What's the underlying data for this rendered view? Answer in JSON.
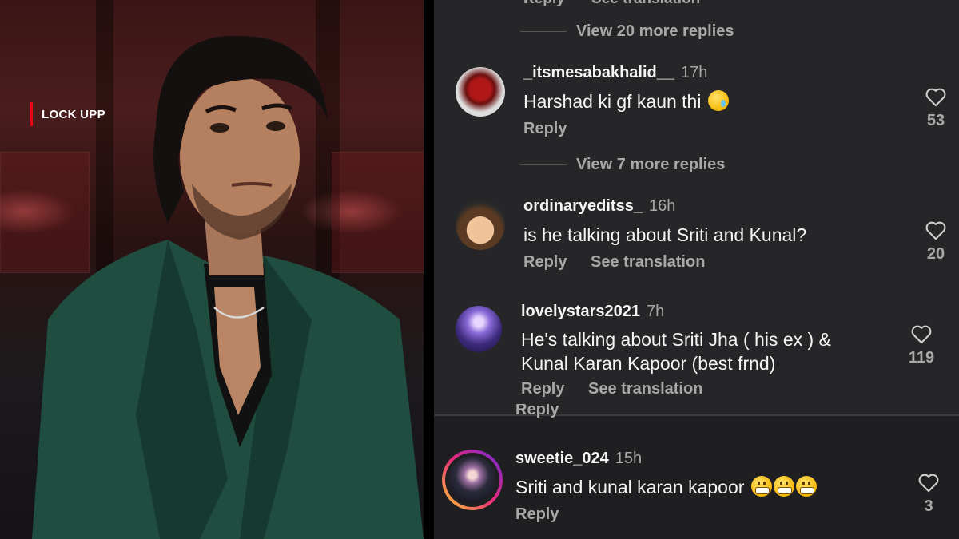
{
  "photo": {
    "show_tag": "LOCK UPP"
  },
  "cut_off_top": {
    "reply": "Reply",
    "translation": "See translation"
  },
  "view_more_1": "View 20 more replies",
  "view_more_2": "View 7 more replies",
  "comments": [
    {
      "username": "_itsmesabakhalid__",
      "time": "17h",
      "text": "Harshad ki gf kaun thi",
      "reply": "Reply",
      "likes": "53"
    },
    {
      "username": "ordinaryeditss_",
      "time": "16h",
      "text": "is he talking about Sriti and Kunal?",
      "reply": "Reply",
      "translation": "See translation",
      "likes": "20"
    },
    {
      "username": "lovelystars2021",
      "time": "7h",
      "text_line1": "He's talking about Sriti Jha (  his ex ) &",
      "text_line2": "Kunal Karan Kapoor (best frnd)",
      "reply": "Reply",
      "translation": "See translation",
      "likes": "119"
    },
    {
      "username": "sweetie_024",
      "time": "15h",
      "text": "Sriti and kunal karan kapoor",
      "reply": "Reply",
      "likes": "3"
    }
  ],
  "cut_off_mid": "Reply",
  "icons": {
    "like": "heart-outline-icon",
    "emoji_1": "face-holding-back-tears-emoji",
    "emoji_2": "grimacing-face-emoji"
  },
  "colors": {
    "panel_bg": "#262628",
    "muted": "#a8a8a8",
    "text": "#f5f5f5",
    "accent_red": "#e50914",
    "story_ring_start": "#f9ce34",
    "story_ring_end": "#c1359c"
  }
}
